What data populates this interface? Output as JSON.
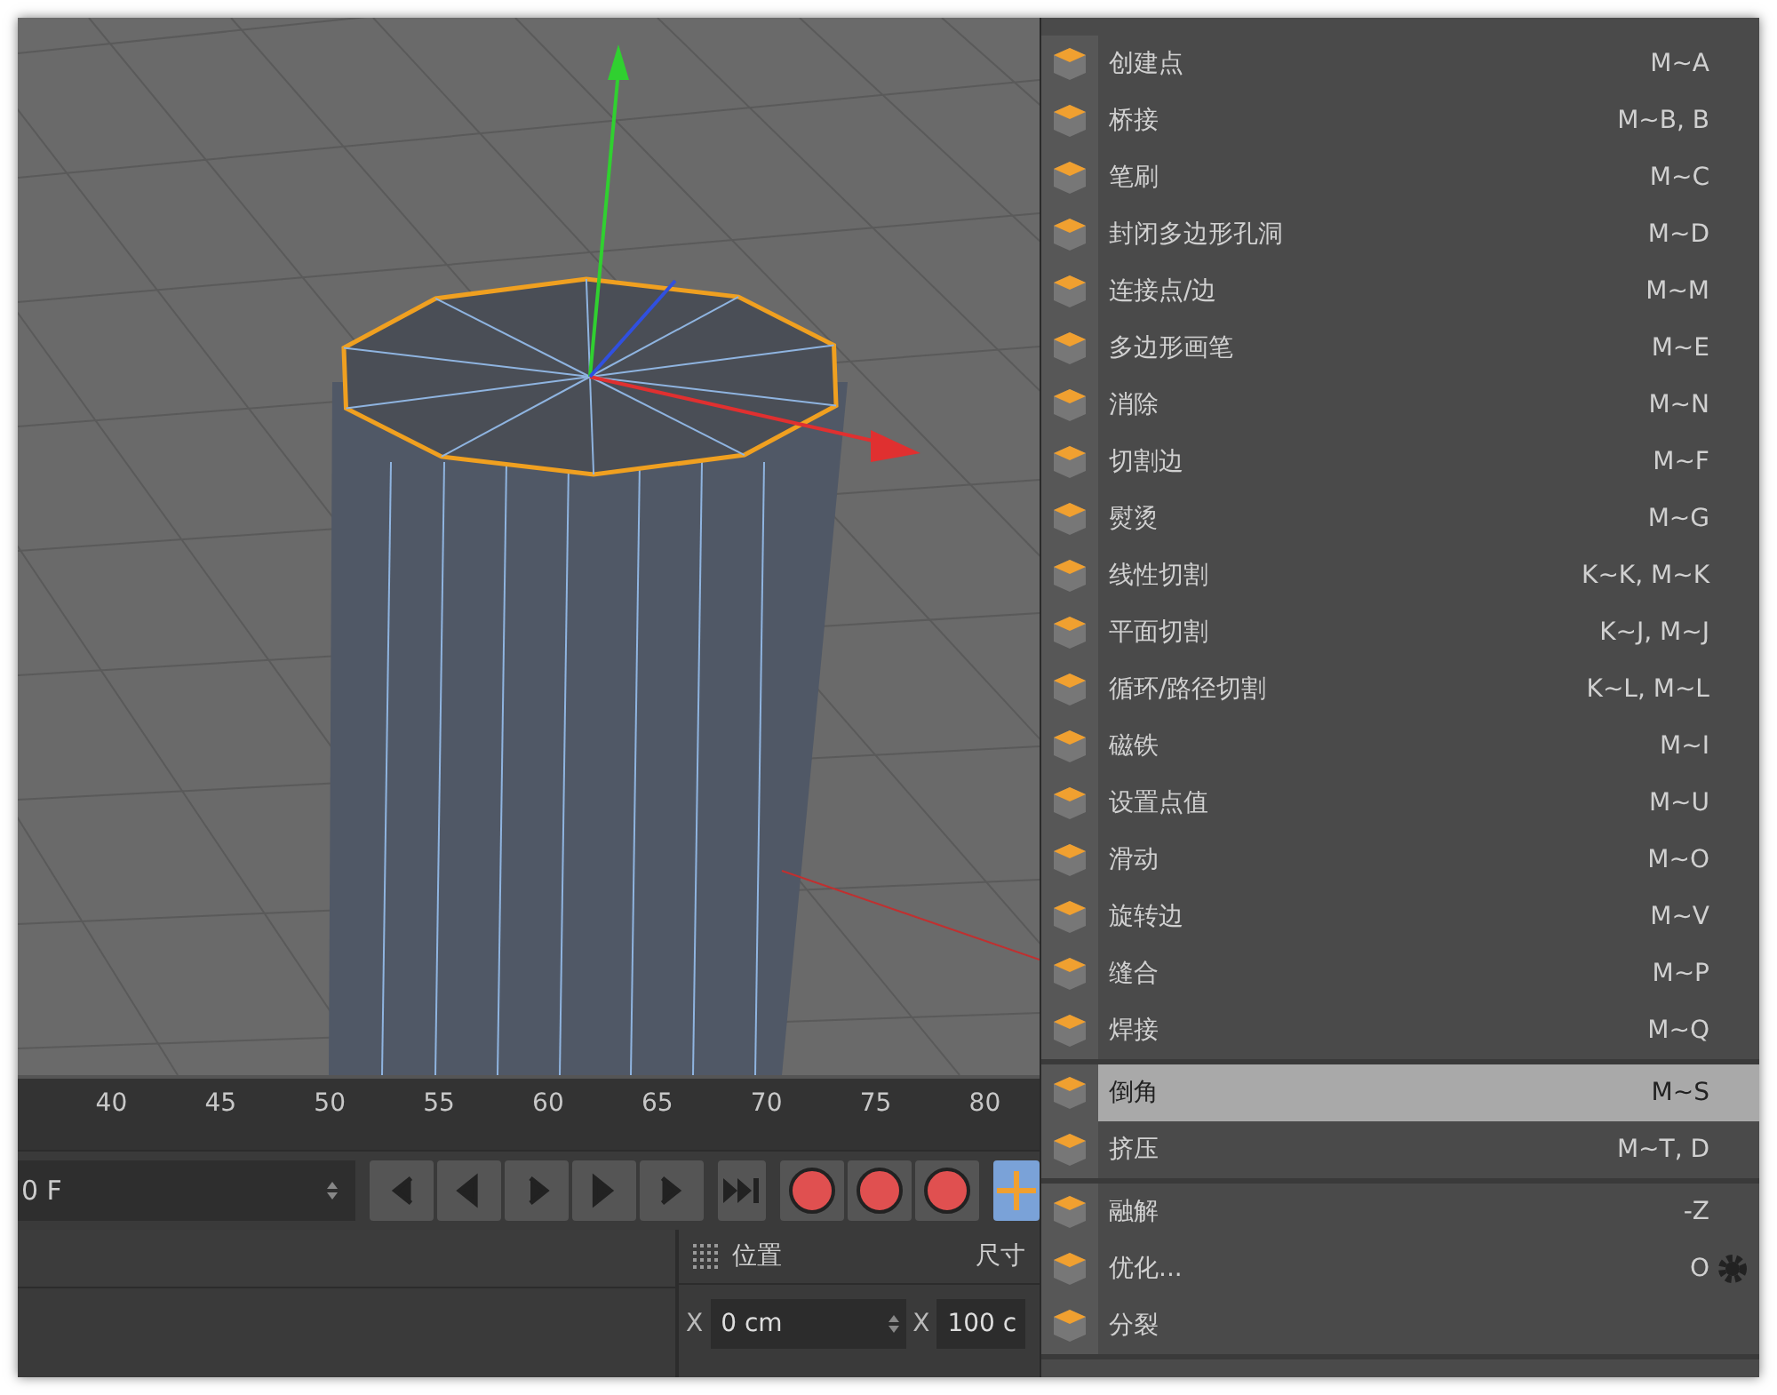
{
  "timeline": {
    "ticks": [
      "40",
      "45",
      "50",
      "55",
      "60",
      "65",
      "70",
      "75",
      "80"
    ]
  },
  "frame_field": {
    "value": "0 F"
  },
  "coordinates": {
    "header": "位置",
    "header_2": "尺寸",
    "rows": [
      {
        "axis": "X",
        "value": "0 cm",
        "axis_2": "X",
        "value_2": "100 c"
      }
    ]
  },
  "menu": {
    "groups": [
      [
        {
          "label": "创建点",
          "shortcut": "M~A",
          "selected": false
        },
        {
          "label": "桥接",
          "shortcut": "M~B, B",
          "selected": false
        },
        {
          "label": "笔刷",
          "shortcut": "M~C",
          "selected": false
        },
        {
          "label": "封闭多边形孔洞",
          "shortcut": "M~D",
          "selected": false
        },
        {
          "label": "连接点/边",
          "shortcut": "M~M",
          "selected": false
        },
        {
          "label": "多边形画笔",
          "shortcut": "M~E",
          "selected": false
        },
        {
          "label": "消除",
          "shortcut": "M~N",
          "selected": false
        },
        {
          "label": "切割边",
          "shortcut": "M~F",
          "selected": false
        },
        {
          "label": "熨烫",
          "shortcut": "M~G",
          "selected": false
        },
        {
          "label": "线性切割",
          "shortcut": "K~K, M~K",
          "selected": false
        },
        {
          "label": "平面切割",
          "shortcut": "K~J, M~J",
          "selected": false
        },
        {
          "label": "循环/路径切割",
          "shortcut": "K~L, M~L",
          "selected": false
        },
        {
          "label": "磁铁",
          "shortcut": "M~I",
          "selected": false
        },
        {
          "label": "设置点值",
          "shortcut": "M~U",
          "selected": false
        },
        {
          "label": "滑动",
          "shortcut": "M~O",
          "selected": false
        },
        {
          "label": "旋转边",
          "shortcut": "M~V",
          "selected": false
        },
        {
          "label": "缝合",
          "shortcut": "M~P",
          "selected": false
        },
        {
          "label": "焊接",
          "shortcut": "M~Q",
          "selected": false
        }
      ],
      [
        {
          "label": "倒角",
          "shortcut": "M~S",
          "selected": true
        },
        {
          "label": "挤压",
          "shortcut": "M~T, D",
          "selected": false
        }
      ],
      [
        {
          "label": "融解",
          "shortcut": "-Z",
          "selected": false,
          "settings": false
        },
        {
          "label": "优化...",
          "shortcut": "O",
          "selected": false,
          "settings": true
        },
        {
          "label": "分裂",
          "selected": false,
          "settings": false
        }
      ]
    ]
  }
}
